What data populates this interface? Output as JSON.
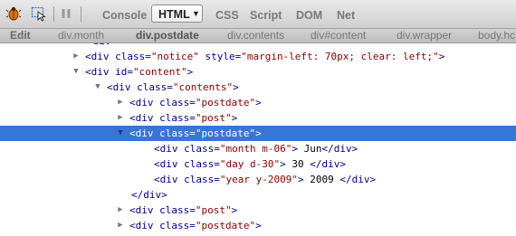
{
  "toolbar": {
    "tabs": {
      "console": "Console",
      "html": "HTML",
      "css": "CSS",
      "script": "Script",
      "dom": "DOM",
      "net": "Net"
    },
    "icons": [
      "firebug-icon",
      "inspect-icon",
      "pause-icon",
      "dropdown-caret-icon"
    ]
  },
  "breadcrumbs": {
    "edit_label": "Edit",
    "items": [
      "div.month",
      "div.postdate",
      "div.contents",
      "div#content",
      "div.wrapper",
      "body.hc"
    ]
  },
  "tree": {
    "r0": {
      "tag": "<div",
      "cls_attr": " class=",
      "cls": "\"notice\"",
      "style_attr": " style=",
      "style": "\"margin-left: 70px; clear: left;\"",
      "end": ">"
    },
    "r1": {
      "tag": "<div",
      "id_attr": " id=",
      "id": "\"content\"",
      "end": ">"
    },
    "r2": {
      "tag": "<div",
      "cls_attr": " class=",
      "cls": "\"contents\"",
      "end": ">"
    },
    "r3": {
      "tag": "<div",
      "cls_attr": " class=",
      "cls": "\"postdate\"",
      "end": ">"
    },
    "r4": {
      "tag": "<div",
      "cls_attr": " class=",
      "cls": "\"post\"",
      "end": ">"
    },
    "r5": {
      "tag": "<div",
      "cls_attr": " class=",
      "cls": "\"postdate\"",
      "end": ">"
    },
    "r6": {
      "tag": "<div",
      "cls_attr": " class=",
      "cls": "\"month m-06\"",
      "end": ">",
      "text": "Jun",
      "close": "</div>"
    },
    "r7": {
      "tag": "<div",
      "cls_attr": " class=",
      "cls": "\"day d-30\"",
      "end": ">",
      "text": "30",
      "close": "</div>"
    },
    "r8": {
      "tag": "<div",
      "cls_attr": " class=",
      "cls": "\"year y-2009\"",
      "end": ">",
      "text": "2009",
      "close": "</div>"
    },
    "r9": {
      "close": "</div>"
    },
    "r10": {
      "tag": "<div",
      "cls_attr": " class=",
      "cls": "\"post\"",
      "end": ">"
    },
    "r11": {
      "tag": "<div",
      "cls_attr": " class=",
      "cls": "\"postdate\"",
      "end": ">"
    }
  },
  "colors": {
    "selection": "#3875d7",
    "tag": "#000088",
    "attr_value": "#880000"
  }
}
